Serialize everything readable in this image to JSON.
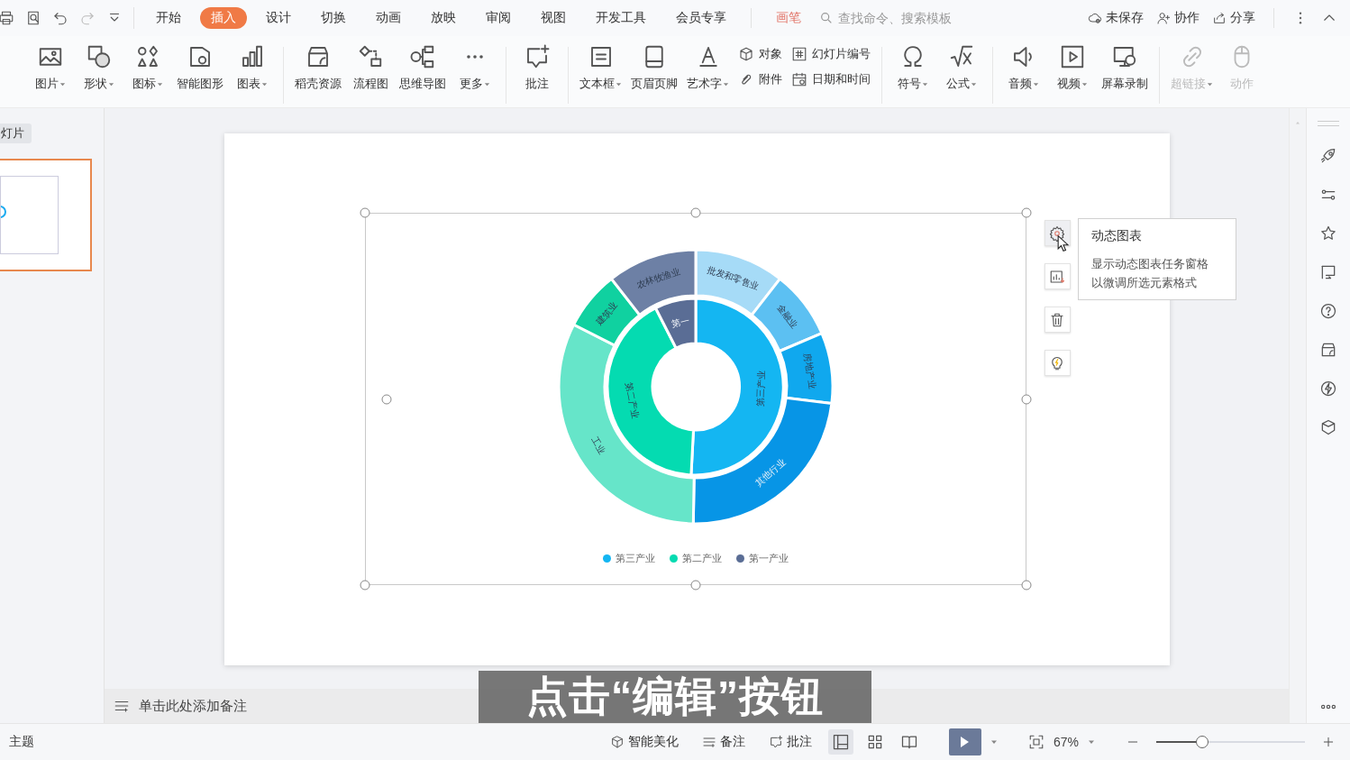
{
  "menu_tabs": [
    {
      "label": "开始",
      "selected": false
    },
    {
      "label": "插入",
      "selected": true
    },
    {
      "label": "设计",
      "selected": false
    },
    {
      "label": "切换",
      "selected": false
    },
    {
      "label": "动画",
      "selected": false
    },
    {
      "label": "放映",
      "selected": false
    },
    {
      "label": "审阅",
      "selected": false
    },
    {
      "label": "视图",
      "selected": false
    },
    {
      "label": "开发工具",
      "selected": false
    },
    {
      "label": "会员专享",
      "selected": false
    }
  ],
  "pen_tab": {
    "label": "画笔"
  },
  "search": {
    "placeholder": "查找命令、搜索模板"
  },
  "header_actions": [
    {
      "label": "未保存"
    },
    {
      "label": "协作"
    },
    {
      "label": "分享"
    }
  ],
  "ribbon_groups": [
    [
      {
        "kind": "large",
        "label": "图片",
        "dropdown": true,
        "disabled": false
      },
      {
        "kind": "large",
        "label": "形状",
        "dropdown": true,
        "disabled": false
      },
      {
        "kind": "large",
        "label": "图标",
        "dropdown": true,
        "disabled": false
      },
      {
        "kind": "large",
        "label": "智能图形",
        "dropdown": false,
        "disabled": false
      },
      {
        "kind": "large",
        "label": "图表",
        "dropdown": true,
        "disabled": false
      }
    ],
    [
      {
        "kind": "large",
        "label": "稻壳资源",
        "dropdown": false,
        "disabled": false
      },
      {
        "kind": "large",
        "label": "流程图",
        "dropdown": false,
        "disabled": false
      },
      {
        "kind": "large",
        "label": "思维导图",
        "dropdown": false,
        "disabled": false
      },
      {
        "kind": "large",
        "label": "更多",
        "dropdown": true,
        "disabled": false
      }
    ],
    [
      {
        "kind": "large",
        "label": "批注",
        "dropdown": false,
        "disabled": false
      }
    ],
    [
      {
        "kind": "large",
        "label": "文本框",
        "dropdown": true,
        "disabled": false
      },
      {
        "kind": "large",
        "label": "页眉页脚",
        "dropdown": false,
        "disabled": false
      },
      {
        "kind": "large",
        "label": "艺术字",
        "dropdown": true,
        "disabled": false
      },
      {
        "kind": "stack",
        "items": [
          {
            "label": "对象",
            "disabled": false
          },
          {
            "label": "附件",
            "disabled": false
          }
        ]
      },
      {
        "kind": "stack",
        "items": [
          {
            "label": "幻灯片编号",
            "disabled": false
          },
          {
            "label": "日期和时间",
            "disabled": false
          }
        ]
      }
    ],
    [
      {
        "kind": "large",
        "label": "符号",
        "dropdown": true,
        "disabled": false
      },
      {
        "kind": "large",
        "label": "公式",
        "dropdown": true,
        "disabled": false
      }
    ],
    [
      {
        "kind": "large",
        "label": "音频",
        "dropdown": true,
        "disabled": false
      },
      {
        "kind": "large",
        "label": "视频",
        "dropdown": true,
        "disabled": false
      },
      {
        "kind": "large",
        "label": "屏幕录制",
        "dropdown": false,
        "disabled": false
      }
    ],
    [
      {
        "kind": "large",
        "label": "超链接",
        "dropdown": true,
        "disabled": true
      },
      {
        "kind": "large",
        "label": "动作",
        "dropdown": false,
        "disabled": true
      }
    ]
  ],
  "slides_panel": {
    "title": "灯片",
    "thumbnails": [
      {
        "selected": true
      }
    ]
  },
  "chart": {
    "inner": [
      {
        "label": "第三产业",
        "color": "#14b6f2"
      },
      {
        "label": "第二产业",
        "color": "#04dbb1"
      },
      {
        "label": "第一",
        "color": "#5a6d95"
      }
    ],
    "outer": [
      {
        "label": "批发和零售业",
        "color": "#a6dbf7"
      },
      {
        "label": "金融业",
        "color": "#5cc0f2"
      },
      {
        "label": "房地产业",
        "color": "#10a8ee"
      },
      {
        "label": "其他行业",
        "color": "#0795e6"
      },
      {
        "label": "工业",
        "color": "#66e5c9"
      },
      {
        "label": "建筑业",
        "color": "#10d1a0"
      },
      {
        "label": "农林牧渔业",
        "color": "#6d80a5"
      }
    ],
    "legend": [
      {
        "label": "第三产业",
        "color": "#14b6f2"
      },
      {
        "label": "第二产业",
        "color": "#04dbb1"
      },
      {
        "label": "第一产业",
        "color": "#5a6d95"
      }
    ]
  },
  "chart_tooltip": {
    "title": "动态图表",
    "lines": [
      "显示动态图表任务窗格",
      "以微调所选元素格式"
    ]
  },
  "notes": {
    "placeholder": "单击此处添加备注"
  },
  "status_bar": {
    "theme": "主题",
    "smart_beautify": "智能美化",
    "notes": "备注",
    "comments": "批注",
    "views": [
      {
        "selected": true
      },
      {
        "selected": false
      },
      {
        "selected": false
      }
    ],
    "zoom": "67%",
    "zoom_slider": {
      "level": 0.31
    }
  },
  "subtitle": "点击“编辑”按钮"
}
